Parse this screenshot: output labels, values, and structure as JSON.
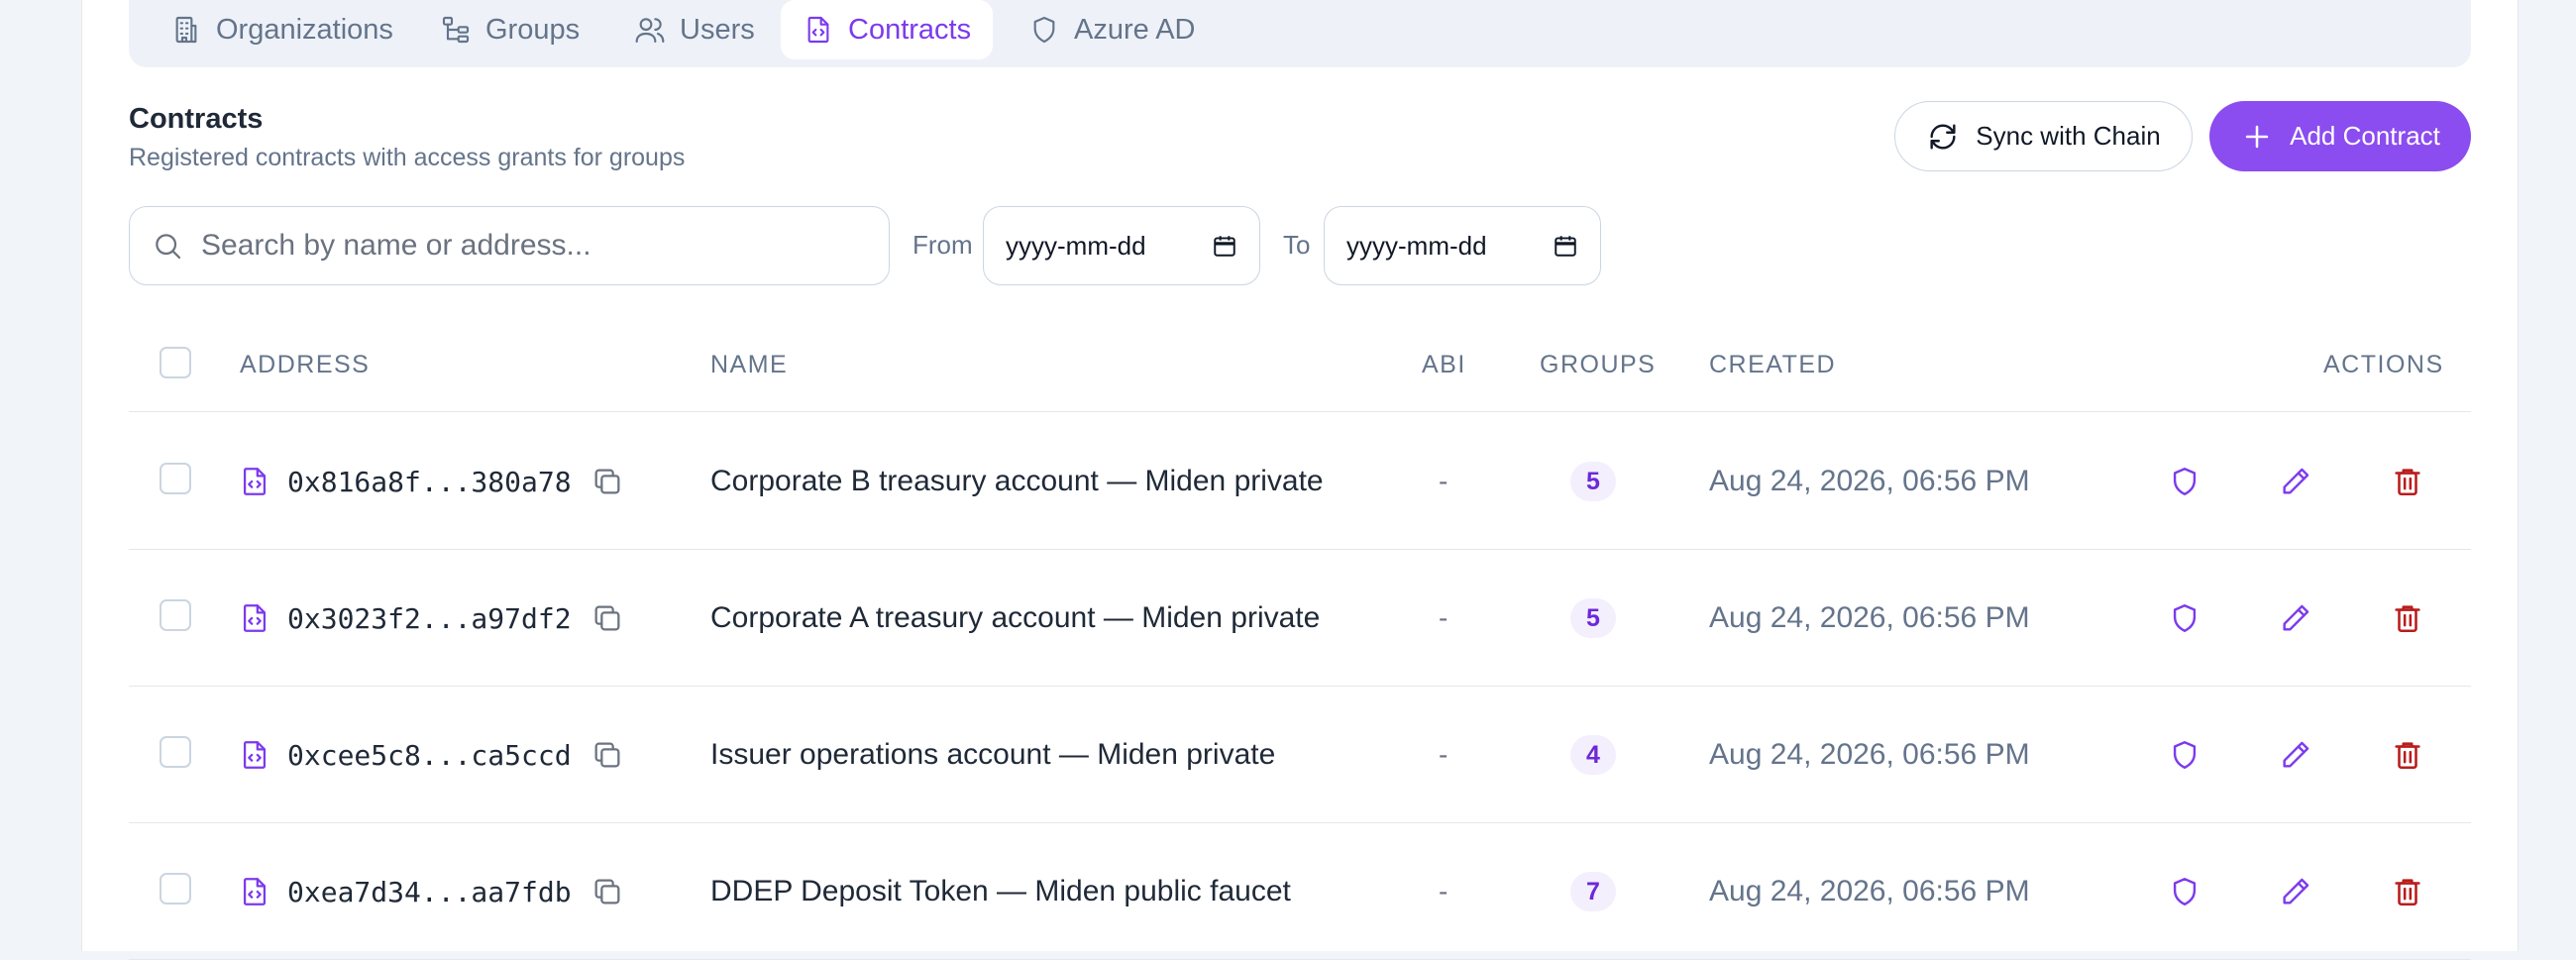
{
  "tabs": [
    {
      "label": "Organizations",
      "icon": "building-icon",
      "active": false
    },
    {
      "label": "Groups",
      "icon": "hierarchy-icon",
      "active": false
    },
    {
      "label": "Users",
      "icon": "users-icon",
      "active": false
    },
    {
      "label": "Contracts",
      "icon": "file-code-icon",
      "active": true
    },
    {
      "label": "Azure AD",
      "icon": "shield-icon",
      "active": false
    }
  ],
  "section": {
    "title": "Contracts",
    "subtitle": "Registered contracts with access grants for groups"
  },
  "buttons": {
    "sync_label": "Sync with Chain",
    "add_label": "Add Contract"
  },
  "filters": {
    "search_placeholder": "Search by name or address...",
    "from_label": "From",
    "to_label": "To",
    "from_value": "yyyy-mm-dd",
    "to_value": "yyyy-mm-dd"
  },
  "table": {
    "headers": {
      "address": "ADDRESS",
      "name": "NAME",
      "abi": "ABI",
      "groups": "GROUPS",
      "created": "CREATED",
      "actions": "ACTIONS"
    },
    "rows": [
      {
        "address": "0x816a8f...380a78",
        "name": "Corporate B treasury account — Miden private",
        "abi": "-",
        "groups": "5",
        "created": "Aug 24, 2026, 06:56 PM"
      },
      {
        "address": "0x3023f2...a97df2",
        "name": "Corporate A treasury account — Miden private",
        "abi": "-",
        "groups": "5",
        "created": "Aug 24, 2026, 06:56 PM"
      },
      {
        "address": "0xcee5c8...ca5ccd",
        "name": "Issuer operations account — Miden private",
        "abi": "-",
        "groups": "4",
        "created": "Aug 24, 2026, 06:56 PM"
      },
      {
        "address": "0xea7d34...aa7fdb",
        "name": "DDEP Deposit Token — Miden public faucet",
        "abi": "-",
        "groups": "7",
        "created": "Aug 24, 2026, 06:56 PM"
      }
    ]
  },
  "colors": {
    "accent": "#8b4cf0",
    "accent_text": "#7c3aed",
    "danger": "#b91c1c"
  }
}
